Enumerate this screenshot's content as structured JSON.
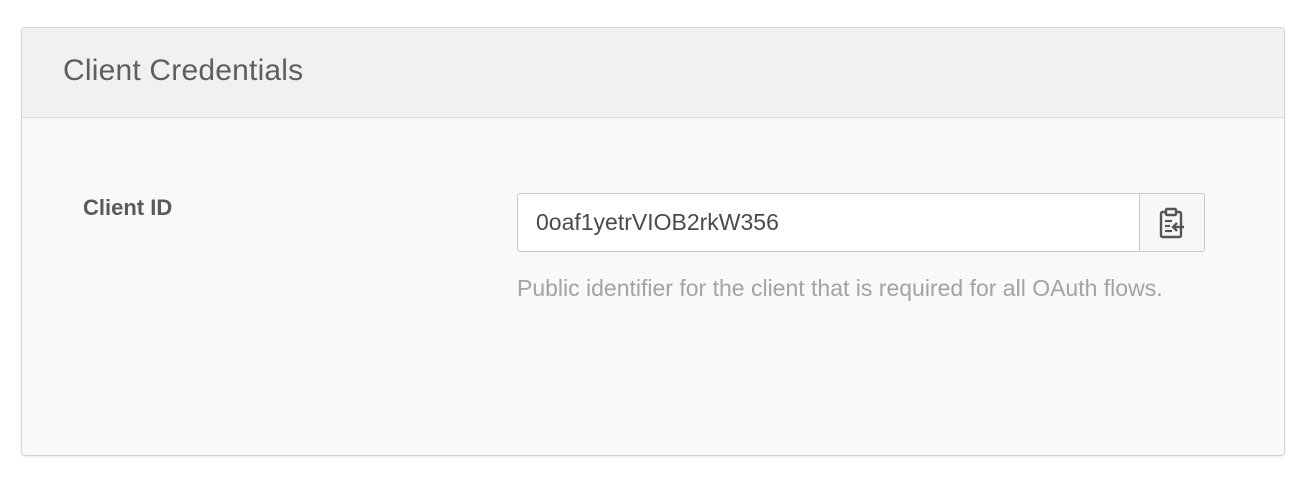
{
  "panel": {
    "title": "Client Credentials"
  },
  "client_id": {
    "label": "Client ID",
    "value": "0oaf1yetrVIOB2rkW356",
    "help_text": "Public identifier for the client that is required for all OAuth flows.",
    "copy_icon": "clipboard-copy-icon"
  }
}
